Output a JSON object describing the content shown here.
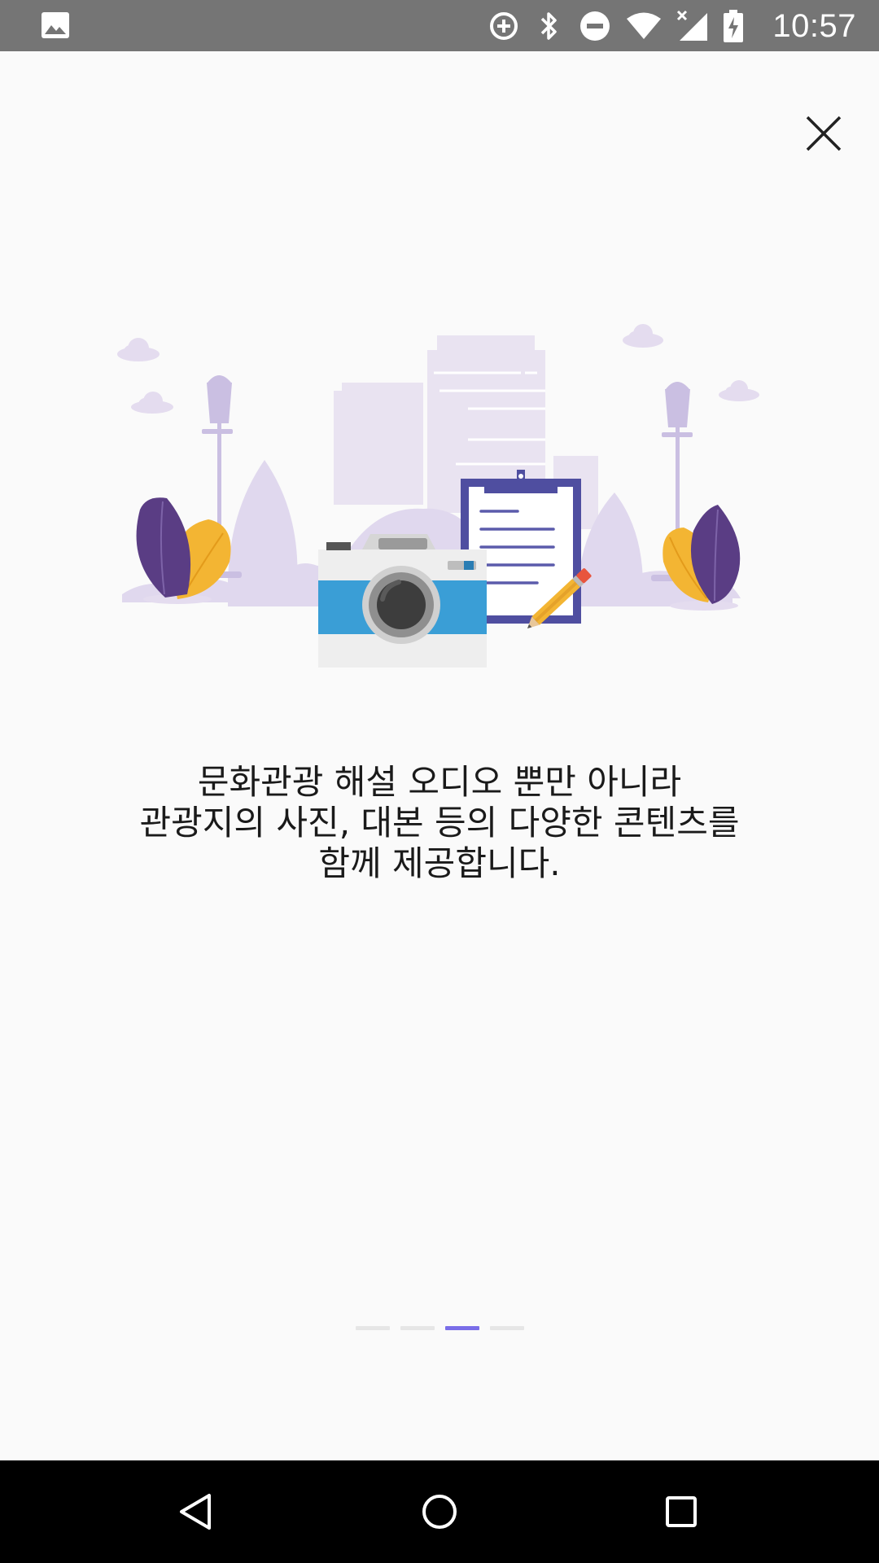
{
  "status_bar": {
    "time": "10:57",
    "icons": [
      "image-icon",
      "data-saver-icon",
      "bluetooth-icon",
      "do-not-disturb-icon",
      "wifi-icon",
      "cell-signal-off-icon",
      "battery-charging-icon"
    ]
  },
  "onboarding": {
    "description_lines": [
      "문화관광 해설 오디오 뿐만 아니라",
      "관광지의 사진, 대본 등의 다양한 콘텐츠를",
      "함께 제공합니다."
    ],
    "page_count": 4,
    "current_page": 3
  },
  "colors": {
    "status_bar": "#757575",
    "background": "#fafafa",
    "indicator_active": "#7a6ee8",
    "indicator_inactive": "#e6e6e6",
    "camera_blue": "#3a9ed6",
    "clipboard": "#4f4ea0",
    "leaf_purple": "#5a3d84",
    "leaf_yellow": "#f3b533",
    "city_lavender": "#e9e3f1"
  },
  "nav_bar": {
    "icons": [
      "back-icon",
      "home-icon",
      "recents-icon"
    ]
  }
}
